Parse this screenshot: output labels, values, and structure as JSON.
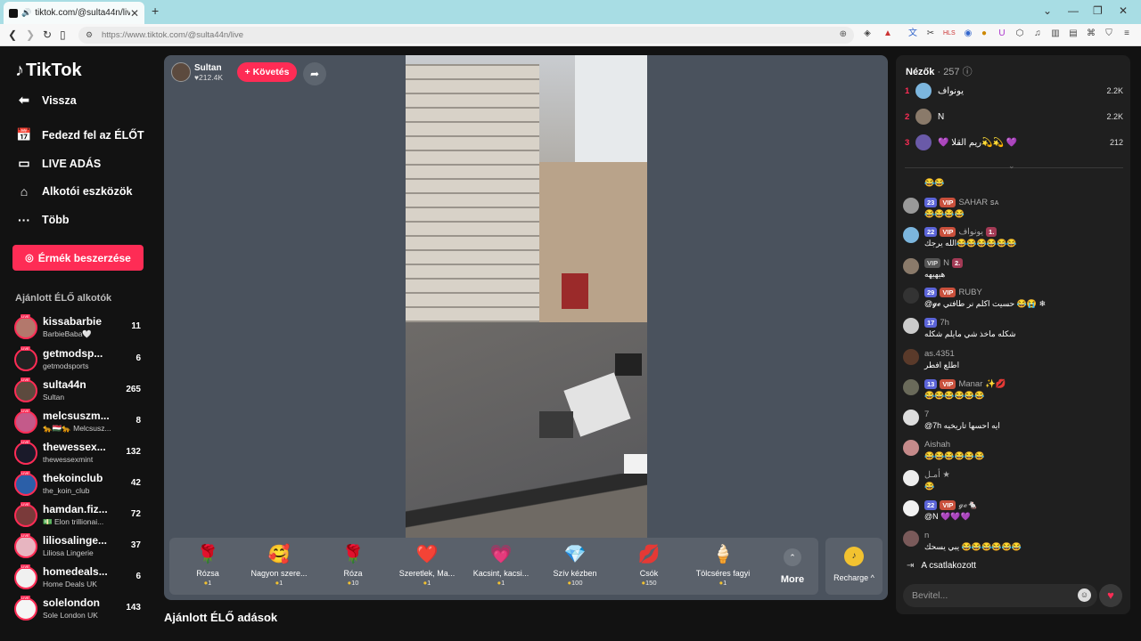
{
  "browser": {
    "tab_title": "tiktok.com/@sulta44n/live",
    "url": "https://www.tiktok.com/@sulta44n/live"
  },
  "sidebar": {
    "logo": "TikTok",
    "back": "Vissza",
    "nav": [
      {
        "label": "Fedezd fel az ÉLŐT",
        "icon": "calendar-live-icon"
      },
      {
        "label": "LIVE ADÁS",
        "icon": "video-camera-icon"
      },
      {
        "label": "Alkotói eszközök",
        "icon": "house-tools-icon"
      },
      {
        "label": "Több",
        "icon": "more-dots-icon"
      }
    ],
    "coin_button": "Érmék beszerzése",
    "recommended_title": "Ajánlott ÉLŐ alkotók",
    "creators": [
      {
        "name": "kissabarbie",
        "sub": "BarbieBaba🤍",
        "count": "11"
      },
      {
        "name": "getmodsp...",
        "sub": "getmodsports",
        "count": "6"
      },
      {
        "name": "sulta44n",
        "sub": "Sultan",
        "count": "265"
      },
      {
        "name": "melcsuszm...",
        "sub": "🐆🇭🇺🐆 Melcsusz...",
        "count": "8"
      },
      {
        "name": "thewessex...",
        "sub": "thewessexmint",
        "count": "132"
      },
      {
        "name": "thekoinclub",
        "sub": "the_koin_club",
        "count": "42"
      },
      {
        "name": "hamdan.fiz...",
        "sub": "💵 Elon trillionai...",
        "count": "72"
      },
      {
        "name": "liliosalinge...",
        "sub": "Liliosa Lingerie",
        "count": "37"
      },
      {
        "name": "homedeals...",
        "sub": "Home Deals UK",
        "count": "6"
      },
      {
        "name": "solelondon",
        "sub": "Sole London UK",
        "count": "143"
      }
    ]
  },
  "player": {
    "host_name": "Sultan",
    "host_likes": "♥212.4K",
    "follow_label": "+ Követés",
    "gifts": [
      {
        "name": "Rózsa",
        "price": "1",
        "icon": "🌹"
      },
      {
        "name": "Nagyon szere...",
        "price": "1",
        "icon": "🥰"
      },
      {
        "name": "Róza",
        "price": "10",
        "icon": "🌹"
      },
      {
        "name": "Szeretlek, Ma...",
        "price": "1",
        "icon": "❤️"
      },
      {
        "name": "Kacsint, kacsi...",
        "price": "1",
        "icon": "💗"
      },
      {
        "name": "Szív kézben",
        "price": "100",
        "icon": "💎"
      },
      {
        "name": "Csók",
        "price": "150",
        "icon": "💋"
      },
      {
        "name": "Tölcséres fagyi",
        "price": "1",
        "icon": "🍦"
      }
    ],
    "more_label": "More",
    "recharge_label": "Recharge ^"
  },
  "below_title": "Ajánlott ÉLŐ adások",
  "chat": {
    "viewers_label": "Nézők",
    "viewers_count": "· 257",
    "top_viewers": [
      {
        "rank": "1",
        "name": "يونواف",
        "score": "2.2K"
      },
      {
        "rank": "2",
        "name": "N",
        "score": "2.2K"
      },
      {
        "rank": "3",
        "name": "💜 ريم القلا💫💫 💜",
        "score": "212"
      }
    ],
    "messages": [
      {
        "lvl": "",
        "vip": "",
        "name": "",
        "rank": "",
        "text": "😂😂"
      },
      {
        "lvl": "23",
        "vip": "VIP",
        "name": "SAHAR ꜱᴀ",
        "rank": "",
        "text": "😂😂😂😂"
      },
      {
        "lvl": "22",
        "vip": "VIP",
        "name": "يونواف",
        "rank": "1.",
        "text": "الله يرجك😂😂😂😂😂😂"
      },
      {
        "lvl": "",
        "vip": "VIP",
        "name": "N",
        "rank": "2.",
        "text": "هيهيهه"
      },
      {
        "lvl": "29",
        "vip": "VIP",
        "name": "RUBY",
        "rank": "",
        "text": "@𝓰𝓮 حسيت اكلم نر طافتي 😂😭 ❄"
      },
      {
        "lvl": "17",
        "vip": "",
        "name": "7h",
        "rank": "",
        "text": "شكله ماخذ شي مايلم شكله"
      },
      {
        "lvl": "",
        "vip": "",
        "name": "as.4351",
        "rank": "",
        "text": "اطلع افطر"
      },
      {
        "lvl": "13",
        "vip": "VIP",
        "name": "Manar ✨💋",
        "rank": "",
        "text": "😂😂😂😂😂😂"
      },
      {
        "lvl": "",
        "vip": "",
        "name": "7",
        "rank": "",
        "text": "@7h ايه احسها تاريخيه"
      },
      {
        "lvl": "",
        "vip": "",
        "name": "Aishah",
        "rank": "",
        "text": "😂😂😂😂😂😂"
      },
      {
        "lvl": "",
        "vip": "",
        "name": "أمـل ★",
        "rank": "",
        "text": "😂"
      },
      {
        "lvl": "22",
        "vip": "VIP",
        "name": "𝓰𝓮🐁",
        "rank": "",
        "text": "@N 💜💜💜"
      },
      {
        "lvl": "",
        "vip": "",
        "name": "n",
        "rank": "",
        "text": "يبي يسحك 😂😂😂😂😂😂"
      }
    ],
    "joined": "A  csatlakozott",
    "input_placeholder": "Bevitel..."
  }
}
